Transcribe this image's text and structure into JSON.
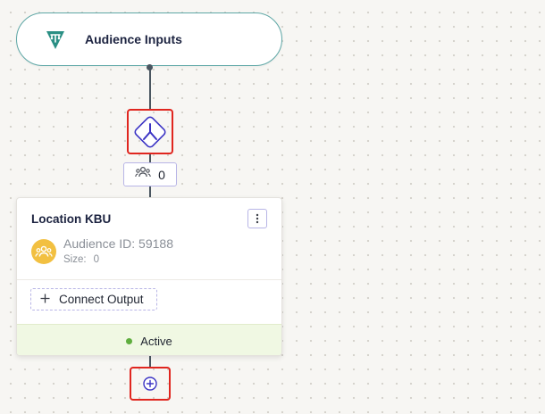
{
  "input_node": {
    "title": "Audience Inputs",
    "icon": "funnel-filter-icon",
    "icon_color": "#2a8f84"
  },
  "merge_node": {
    "icon": "merge-branch-icon",
    "accent": "#3b33c4"
  },
  "count_pill": {
    "icon": "people-group-icon",
    "value": "0"
  },
  "audience_card": {
    "title": "Location KBU",
    "menu_icon": "more-vertical-icon",
    "avatar_icon": "people-group-icon",
    "avatar_color": "#f2c041",
    "audience_id_label": "Audience ID: 59188",
    "size_label": "Size:",
    "size_value": "0",
    "connect_output_label": "Connect Output",
    "status": "Active",
    "status_color": "#5fae3e"
  },
  "add_node": {
    "icon": "plus-circle-icon"
  },
  "colors": {
    "highlight": "#e0261f",
    "connector": "#4a5660",
    "status_bg": "#f0f8e3"
  }
}
